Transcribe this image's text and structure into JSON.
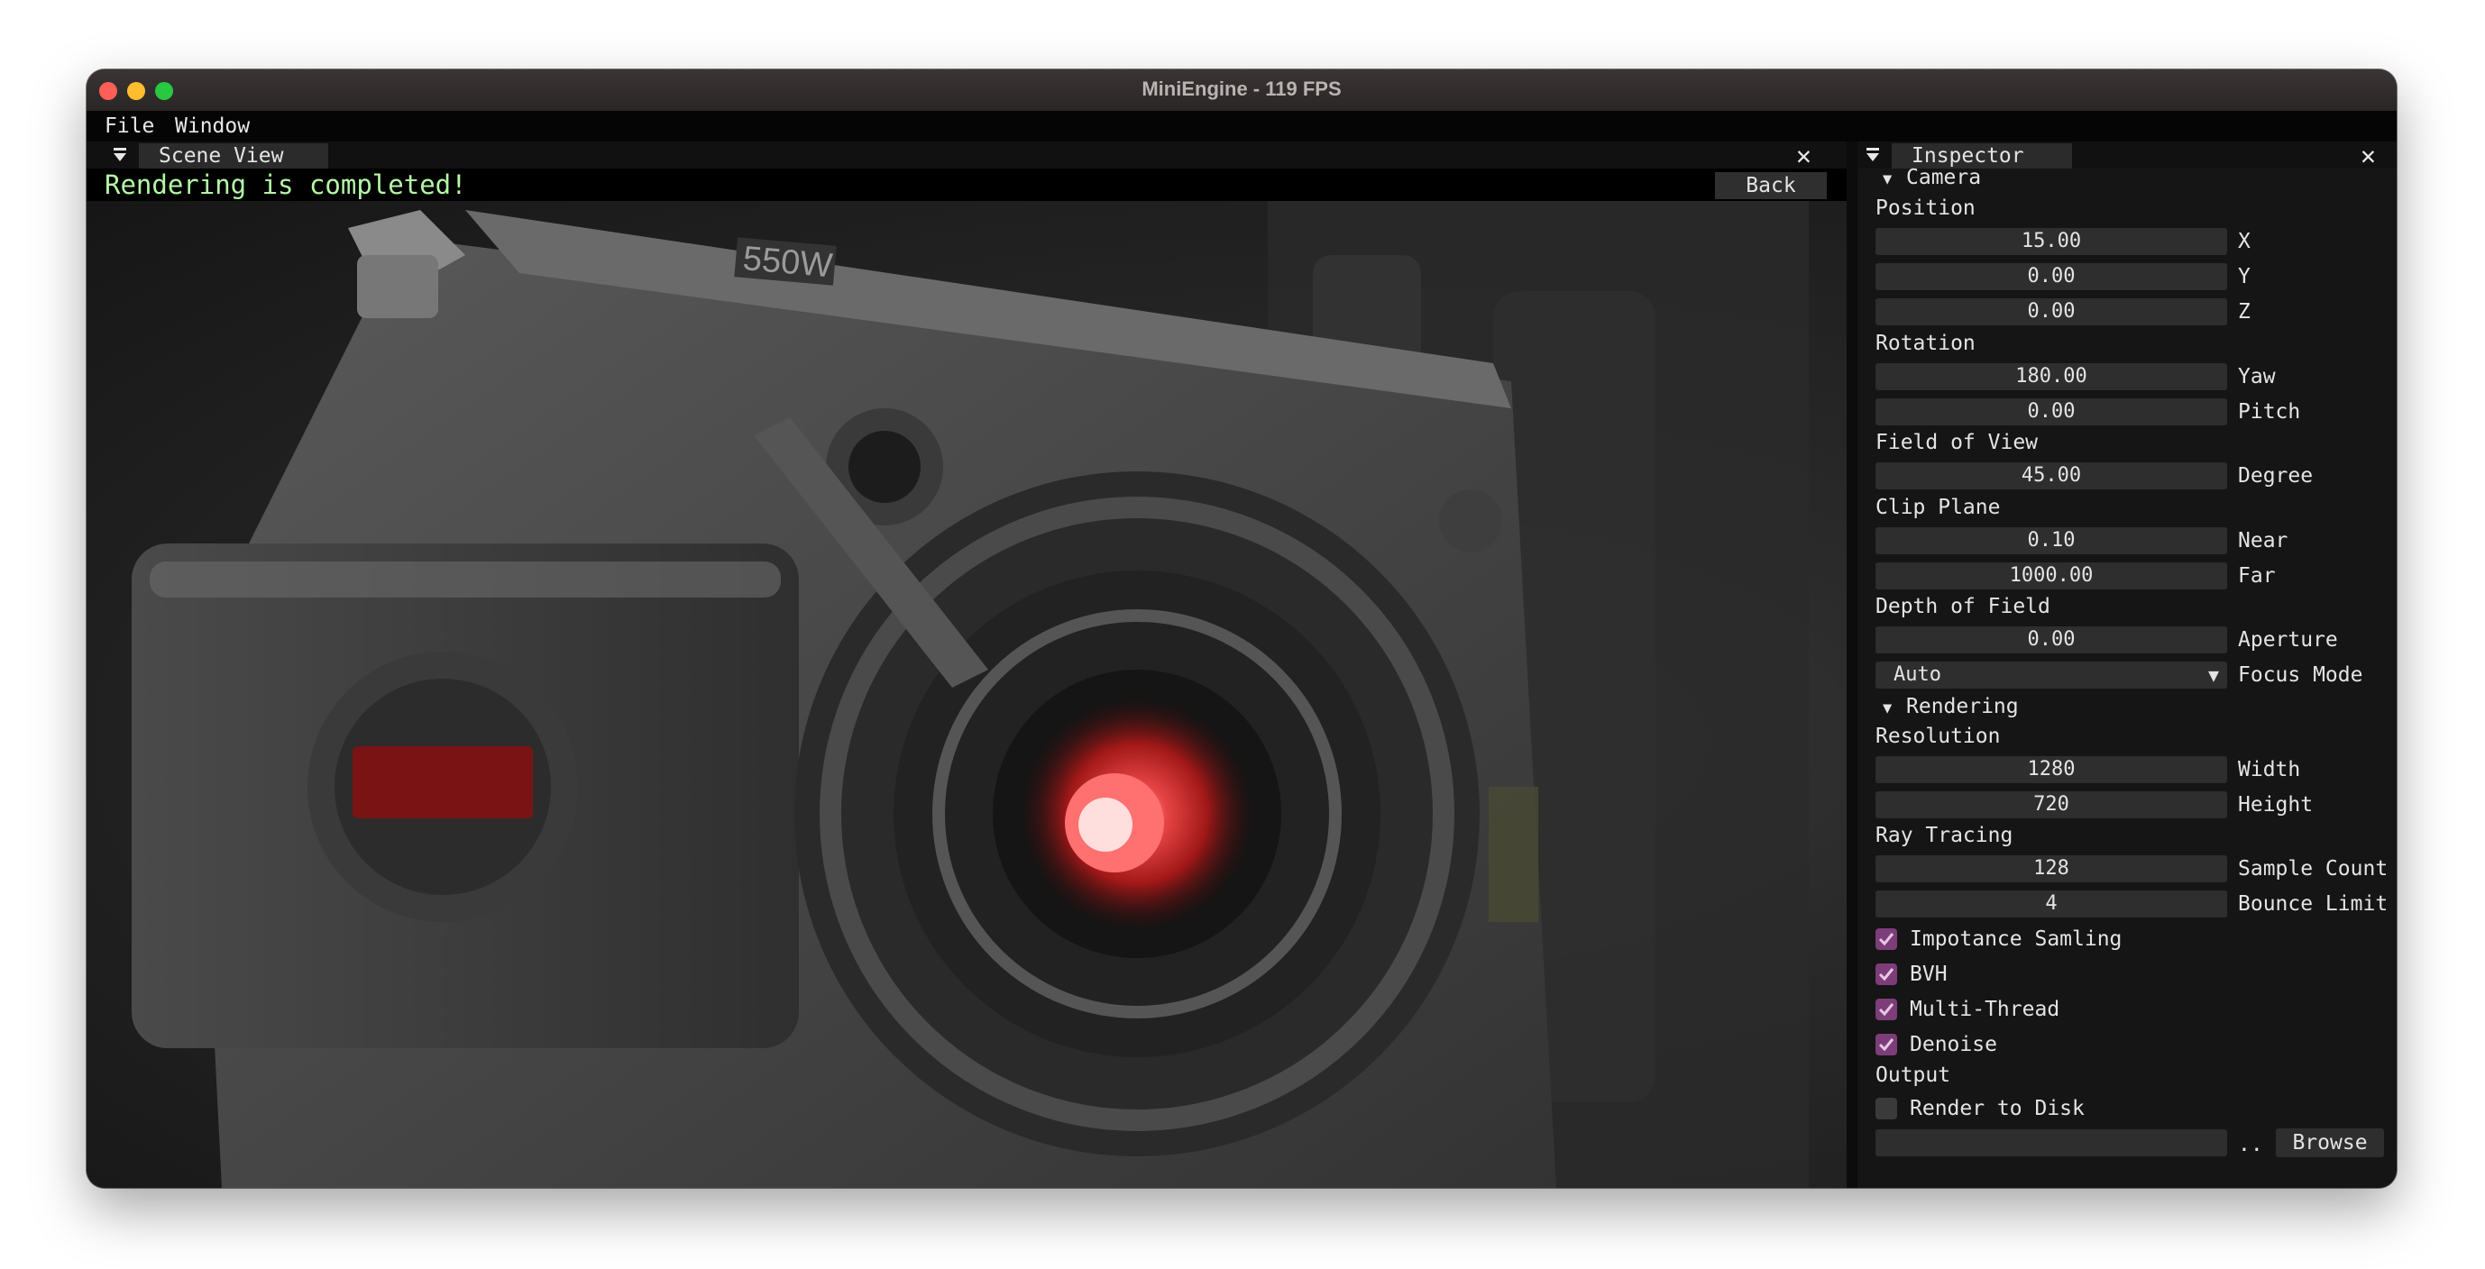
{
  "window": {
    "title": "MiniEngine - 119 FPS"
  },
  "menu": {
    "file": "File",
    "window": "Window"
  },
  "scene_view": {
    "tab_label": "Scene View",
    "status": "Rendering is completed!",
    "back_label": "Back",
    "close_glyph": "✕",
    "viewport_text": {
      "power_label": "550W"
    }
  },
  "inspector": {
    "tab_label": "Inspector",
    "close_glyph": "✕",
    "camera": {
      "header": "Camera",
      "position": {
        "label": "Position",
        "x": "15.00",
        "x_label": "X",
        "y": "0.00",
        "y_label": "Y",
        "z": "0.00",
        "z_label": "Z"
      },
      "rotation": {
        "label": "Rotation",
        "yaw": "180.00",
        "yaw_label": "Yaw",
        "pitch": "0.00",
        "pitch_label": "Pitch"
      },
      "fov": {
        "label": "Field of View",
        "value": "45.00",
        "unit_label": "Degree"
      },
      "clip": {
        "label": "Clip Plane",
        "near": "0.10",
        "near_label": "Near",
        "far": "1000.00",
        "far_label": "Far"
      },
      "dof": {
        "label": "Depth of Field",
        "aperture": "0.00",
        "aperture_label": "Aperture",
        "focus_mode": "Auto",
        "focus_mode_label": "Focus Mode"
      }
    },
    "rendering": {
      "header": "Rendering",
      "resolution": {
        "label": "Resolution",
        "width": "1280",
        "width_label": "Width",
        "height": "720",
        "height_label": "Height"
      },
      "ray_tracing": {
        "label": "Ray Tracing",
        "samples": "128",
        "samples_label": "Sample Count",
        "bounces": "4",
        "bounces_label": "Bounce Limit"
      },
      "options": [
        {
          "label": "Impotance Samling",
          "checked": true
        },
        {
          "label": "BVH",
          "checked": true
        },
        {
          "label": "Multi-Thread",
          "checked": true
        },
        {
          "label": "Denoise",
          "checked": true
        }
      ],
      "output": {
        "label": "Output",
        "render_to_disk": "Render to Disk",
        "render_to_disk_checked": false,
        "path": "",
        "ellipsis": "..",
        "browse_label": "Browse"
      }
    }
  },
  "colors": {
    "status_text": "#b4f7a6",
    "checkbox_checked": "#7d3d79",
    "lens_glow": "#ff3a3a"
  },
  "icons": {
    "collapse": "tab-collapse-icon",
    "close": "close-icon",
    "expand_triangle": "triangle-down-icon",
    "checkmark": "checkmark-icon",
    "dropdown": "dropdown-arrow-icon"
  }
}
